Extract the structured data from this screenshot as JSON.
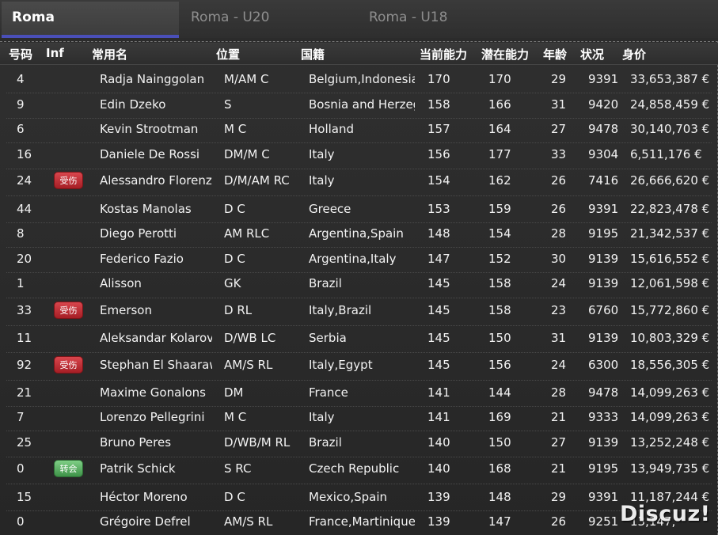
{
  "tabs": [
    {
      "label": "Roma",
      "active": true
    },
    {
      "label": "Roma - U20",
      "active": false
    },
    {
      "label": "Roma - U18",
      "active": false
    }
  ],
  "columns": {
    "number": "号码",
    "inf": "Inf",
    "name": "常用名",
    "position": "位置",
    "nationality": "国籍",
    "current_ability": "当前能力",
    "potential_ability": "潜在能力",
    "age": "年龄",
    "condition": "状况",
    "value": "身价"
  },
  "badge_colors": {
    "injured": "#c0303a",
    "transfer": "#5aae62"
  },
  "players": [
    {
      "number": "4",
      "inf": "",
      "name": "Radja Nainggolan",
      "position": "M/AM C",
      "nationality": "Belgium,Indonesia",
      "ca": "170",
      "pa": "170",
      "age": "29",
      "condition": "9391",
      "value": "33,653,387 €"
    },
    {
      "number": "9",
      "inf": "",
      "name": "Edin Dzeko",
      "position": "S",
      "nationality": "Bosnia and Herzeg",
      "ca": "158",
      "pa": "166",
      "age": "31",
      "condition": "9420",
      "value": "24,858,459 €"
    },
    {
      "number": "6",
      "inf": "",
      "name": "Kevin Strootman",
      "position": "M C",
      "nationality": "Holland",
      "ca": "157",
      "pa": "164",
      "age": "27",
      "condition": "9478",
      "value": "30,140,703 €"
    },
    {
      "number": "16",
      "inf": "",
      "name": "Daniele De Rossi",
      "position": "DM/M C",
      "nationality": "Italy",
      "ca": "156",
      "pa": "177",
      "age": "33",
      "condition": "9304",
      "value": "6,511,176 €"
    },
    {
      "number": "24",
      "inf": "受伤",
      "inf_type": "injured",
      "name": "Alessandro Florenzi",
      "position": "D/M/AM RC",
      "nationality": "Italy",
      "ca": "154",
      "pa": "162",
      "age": "26",
      "condition": "7416",
      "value": "26,666,620 €"
    },
    {
      "number": "44",
      "inf": "",
      "name": "Kostas Manolas",
      "position": "D C",
      "nationality": "Greece",
      "ca": "153",
      "pa": "159",
      "age": "26",
      "condition": "9391",
      "value": "22,823,478 €"
    },
    {
      "number": "8",
      "inf": "",
      "name": "Diego Perotti",
      "position": "AM RLC",
      "nationality": "Argentina,Spain",
      "ca": "148",
      "pa": "154",
      "age": "28",
      "condition": "9195",
      "value": "21,342,537 €"
    },
    {
      "number": "20",
      "inf": "",
      "name": "Federico Fazio",
      "position": "D C",
      "nationality": "Argentina,Italy",
      "ca": "147",
      "pa": "152",
      "age": "30",
      "condition": "9139",
      "value": "15,616,552 €"
    },
    {
      "number": "1",
      "inf": "",
      "name": "Alisson",
      "position": "GK",
      "nationality": "Brazil",
      "ca": "145",
      "pa": "158",
      "age": "24",
      "condition": "9139",
      "value": "12,061,598 €"
    },
    {
      "number": "33",
      "inf": "受伤",
      "inf_type": "injured",
      "name": "Emerson",
      "position": "D RL",
      "nationality": "Italy,Brazil",
      "ca": "145",
      "pa": "158",
      "age": "23",
      "condition": "6760",
      "value": "15,772,860 €"
    },
    {
      "number": "11",
      "inf": "",
      "name": "Aleksandar Kolarov",
      "position": "D/WB LC",
      "nationality": "Serbia",
      "ca": "145",
      "pa": "150",
      "age": "31",
      "condition": "9139",
      "value": "10,803,329 €"
    },
    {
      "number": "92",
      "inf": "受伤",
      "inf_type": "injured",
      "name": "Stephan El Shaaraw",
      "position": "AM/S RL",
      "nationality": "Italy,Egypt",
      "ca": "145",
      "pa": "156",
      "age": "24",
      "condition": "6300",
      "value": "18,556,305 €"
    },
    {
      "number": "21",
      "inf": "",
      "name": "Maxime Gonalons",
      "position": "DM",
      "nationality": "France",
      "ca": "141",
      "pa": "144",
      "age": "28",
      "condition": "9478",
      "value": "14,099,263 €"
    },
    {
      "number": "7",
      "inf": "",
      "name": "Lorenzo Pellegrini",
      "position": "M C",
      "nationality": "Italy",
      "ca": "141",
      "pa": "169",
      "age": "21",
      "condition": "9333",
      "value": "14,099,263 €"
    },
    {
      "number": "25",
      "inf": "",
      "name": "Bruno Peres",
      "position": "D/WB/M RL",
      "nationality": "Brazil",
      "ca": "140",
      "pa": "150",
      "age": "27",
      "condition": "9139",
      "value": "13,252,248 €"
    },
    {
      "number": "0",
      "inf": "转会",
      "inf_type": "transfer",
      "name": "Patrik Schick",
      "position": "S RC",
      "nationality": "Czech Republic",
      "ca": "140",
      "pa": "168",
      "age": "21",
      "condition": "9195",
      "value": "13,949,735 €"
    },
    {
      "number": "15",
      "inf": "",
      "name": "Héctor Moreno",
      "position": "D C",
      "nationality": "Mexico,Spain",
      "ca": "139",
      "pa": "148",
      "age": "29",
      "condition": "9391",
      "value": "11,187,244 €"
    },
    {
      "number": "0",
      "inf": "",
      "name": "Grégoire Defrel",
      "position": "AM/S RL",
      "nationality": "France,Martinique",
      "ca": "139",
      "pa": "147",
      "age": "26",
      "condition": "9251",
      "value": "13,147,"
    }
  ],
  "watermark": "Discuz!"
}
